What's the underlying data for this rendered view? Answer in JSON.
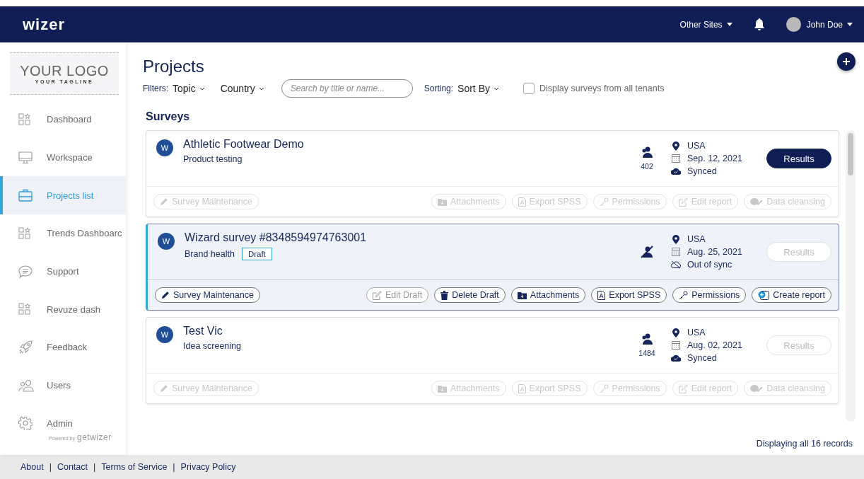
{
  "header": {
    "logo": "wizer",
    "other_sites": "Other Sites",
    "user": "John Doe"
  },
  "sidebar": {
    "logo": {
      "title": "YOUR LOGO",
      "tagline": "YOUR TAGLINE"
    },
    "items": [
      {
        "label": "Dashboard",
        "selected": false
      },
      {
        "label": "Workspace",
        "selected": false
      },
      {
        "label": "Projects list",
        "selected": true
      },
      {
        "label": "Trends Dashboarc",
        "selected": false
      },
      {
        "label": "Support",
        "selected": false
      },
      {
        "label": "Revuze dash",
        "selected": false
      },
      {
        "label": "Feedback",
        "selected": false
      },
      {
        "label": "Users",
        "selected": false
      },
      {
        "label": "Admin",
        "selected": false
      }
    ],
    "powered_by": {
      "prefix": "Powered by",
      "brand": "getwizer"
    }
  },
  "page": {
    "title": "Projects",
    "filters_label": "Filters:",
    "filters": [
      "Topic",
      "Country"
    ],
    "search": {
      "placeholder": "Search by title or name..."
    },
    "sorting_label": "Sorting:",
    "sort": "Sort By",
    "all_tenants": {
      "label": "Display surveys from all tenants",
      "checked": false
    },
    "section": "Surveys"
  },
  "surveys": [
    {
      "avatar": "W",
      "title": "Athletic Footwear Demo",
      "subtitle": "Product testing",
      "respondents": "402",
      "country": "USA",
      "date": "Sep. 12, 2021",
      "sync": "Synced",
      "synced": true,
      "results": "Results",
      "results_enabled": true,
      "selected": false,
      "actions": [
        {
          "label": "Survey Maintenance",
          "kind": "maintenance",
          "disabled": true
        },
        {
          "label": "Attachments",
          "kind": "attachments",
          "disabled": true
        },
        {
          "label": "Export SPSS",
          "kind": "export",
          "disabled": true
        },
        {
          "label": "Permissions",
          "kind": "permissions",
          "disabled": true
        },
        {
          "label": "Edit report",
          "kind": "edit",
          "disabled": true
        },
        {
          "label": "Data cleansing",
          "kind": "cleansing",
          "disabled": true
        }
      ]
    },
    {
      "avatar": "W",
      "title": "Wizard survey #8348594974763001",
      "subtitle": "Brand health",
      "badge": "Draft",
      "country": "USA",
      "date": "Aug. 25, 2021",
      "sync": "Out of sync",
      "synced": false,
      "results": "Results",
      "results_enabled": false,
      "selected": true,
      "actions": [
        {
          "label": "Survey Maintenance",
          "kind": "maintenance",
          "disabled": false
        },
        {
          "label": "Edit Draft",
          "kind": "edit",
          "disabled": true
        },
        {
          "label": "Delete Draft",
          "kind": "delete",
          "disabled": false
        },
        {
          "label": "Attachments",
          "kind": "attachments",
          "disabled": false
        },
        {
          "label": "Export SPSS",
          "kind": "export",
          "disabled": false
        },
        {
          "label": "Permissions",
          "kind": "permissions",
          "disabled": false
        },
        {
          "label": "Create report",
          "kind": "create",
          "disabled": false
        }
      ]
    },
    {
      "avatar": "W",
      "title": "Test Vic",
      "subtitle": "Idea screening",
      "respondents": "1484",
      "country": "USA",
      "date": "Aug. 02, 2021",
      "sync": "Synced",
      "synced": true,
      "results": "Results",
      "results_enabled": false,
      "selected": false,
      "actions": [
        {
          "label": "Survey Maintenance",
          "kind": "maintenance",
          "disabled": true
        },
        {
          "label": "Attachments",
          "kind": "attachments",
          "disabled": true
        },
        {
          "label": "Export SPSS",
          "kind": "export",
          "disabled": true
        },
        {
          "label": "Permissions",
          "kind": "permissions",
          "disabled": true
        },
        {
          "label": "Edit report",
          "kind": "edit",
          "disabled": true
        },
        {
          "label": "Data cleansing",
          "kind": "cleansing",
          "disabled": true
        }
      ]
    }
  ],
  "records": "Displaying all 16 records",
  "footer": {
    "links": [
      "About",
      "Contact",
      "Terms of Service",
      "Privacy Policy"
    ],
    "separators": [
      "|",
      "|",
      "|"
    ]
  }
}
